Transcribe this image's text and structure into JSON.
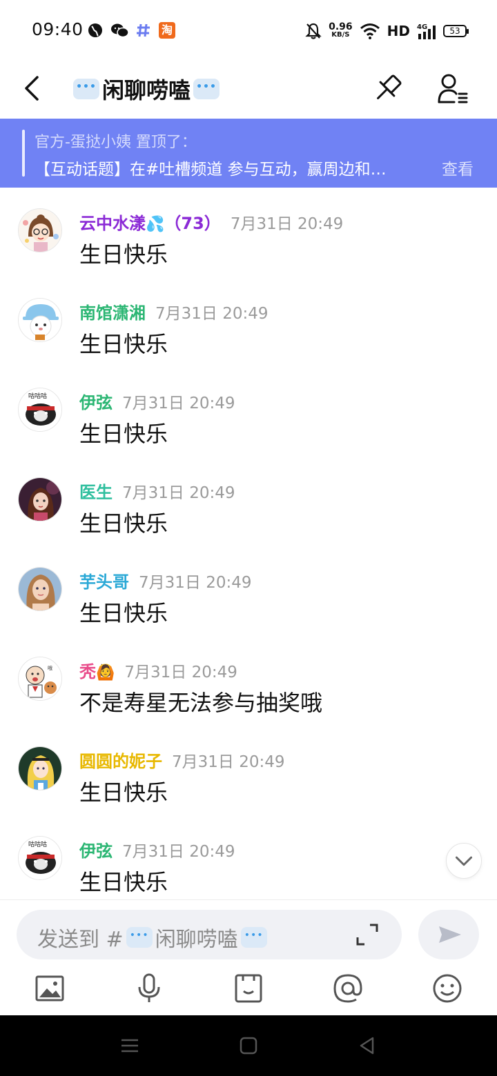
{
  "status_bar": {
    "time": "09:40",
    "app_icons": [
      "globe-icon",
      "wechat-icon",
      "hash-icon",
      "taobao-icon"
    ],
    "taobao_label": "淘",
    "net_speed_value": "0.96",
    "net_speed_unit": "KB/S",
    "signal_label": "HD",
    "network_type": "4G",
    "battery": "53"
  },
  "header": {
    "title": "闲聊唠嗑",
    "colors": {
      "bubble": "#3a9be8"
    }
  },
  "pinned": {
    "line1": "官方-蛋挞小姨 置顶了：",
    "line2": "【互动话题】在#吐槽频道 参与互动，赢周边和…",
    "view_label": "查看",
    "color": "#7082f4"
  },
  "messages": [
    {
      "name": "云中水漾",
      "badge": "💦",
      "suffix": "（73）",
      "name_color": "#8b2ad6",
      "time": "7月31日 20:49",
      "text": "生日快乐",
      "avatar": "girl-glasses"
    },
    {
      "name": "南馆潇湘",
      "badge": "",
      "suffix": "",
      "name_color": "#2bb673",
      "time": "7月31日 20:49",
      "text": "生日快乐",
      "avatar": "bear-hat"
    },
    {
      "name": "伊弦",
      "badge": "",
      "suffix": "",
      "name_color": "#2bb673",
      "time": "7月31日 20:49",
      "text": "生日快乐",
      "avatar": "meme-dog"
    },
    {
      "name": "医生",
      "badge": "",
      "suffix": "",
      "name_color": "#2fbf9e",
      "time": "7月31日 20:49",
      "text": "生日快乐",
      "avatar": "anime-girl"
    },
    {
      "name": "芋头哥",
      "badge": "",
      "suffix": "",
      "name_color": "#2aa8d6",
      "time": "7月31日 20:49",
      "text": "生日快乐",
      "avatar": "woman-portrait"
    },
    {
      "name": "秃",
      "badge": "🙆",
      "suffix": "",
      "name_color": "#e94b8a",
      "time": "7月31日 20:49",
      "text": "不是寿星无法参与抽奖哦",
      "avatar": "old-man-dog"
    },
    {
      "name": "圆圆的妮子",
      "badge": "",
      "suffix": "",
      "name_color": "#e8b800",
      "time": "7月31日 20:49",
      "text": "生日快乐",
      "avatar": "alice"
    },
    {
      "name": "伊弦",
      "badge": "",
      "suffix": "",
      "name_color": "#2bb673",
      "time": "7月31日 20:49",
      "text": "生日快乐",
      "avatar": "meme-dog"
    }
  ],
  "input": {
    "placeholder_prefix": "发送到 #",
    "placeholder_channel": "闲聊唠嗑"
  },
  "toolbar": [
    "image-icon",
    "microphone-icon",
    "sticker-icon",
    "mention-icon",
    "emoji-icon"
  ],
  "nav": [
    "menu-icon",
    "home-icon",
    "back-icon"
  ]
}
